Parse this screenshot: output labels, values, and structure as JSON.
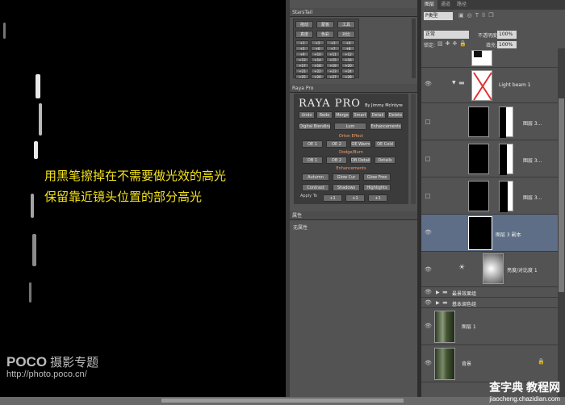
{
  "canvas": {
    "annotation_line1": "用黑笔擦掉在不需要做光效的高光",
    "annotation_line2": "保留靠近镜头位置的部分高光",
    "watermark_brand": "POCO",
    "watermark_sub": "摄影专题",
    "watermark_url": "http://photo.poco.cn/"
  },
  "startail": {
    "title": "StarsTail",
    "row1": [
      "拖动",
      "蒙板",
      "工具"
    ],
    "row2": [
      "真度",
      "色彩",
      "对比"
    ],
    "grid": [
      "+1",
      "+2",
      "+3",
      "+4",
      "+5",
      "+6",
      "+7",
      "+8",
      "+9",
      "+10",
      "+11",
      "+12",
      "+13",
      "+14",
      "+15",
      "+16",
      "+17",
      "+18",
      "+19",
      "+20",
      "+21",
      "+22",
      "+23",
      "+24",
      "+25",
      "+26",
      "+27",
      "+28"
    ]
  },
  "raya": {
    "tab": "Raya Pro",
    "logo": "RAYA PRO",
    "byline": "By Jimmy McIntyre",
    "row1": [
      "Undo",
      "Redo",
      "Merge",
      "Smart",
      "Detail",
      "Delete"
    ],
    "tabs": [
      "Digital Blending",
      "Lum",
      "Enhancements"
    ],
    "orton_label": "Orton Effect",
    "orton": [
      "OE 1",
      "OE 2",
      "OE Warm",
      "OE Cold"
    ],
    "dodge_label": "Dodge/Burn",
    "dodge": [
      "DB 1",
      "DB 2",
      "DB Details",
      "Details"
    ],
    "enh_label": "Enhancements",
    "enh1": [
      "Autumn",
      "Glow Cur",
      "Glow Free"
    ],
    "enh2": [
      "Contrast",
      "Shadows",
      "Highlights"
    ],
    "apply_label": "Apply To",
    "apply": [
      "+1",
      "+1",
      "+1"
    ]
  },
  "properties": {
    "title": "属性",
    "content": "无属性"
  },
  "layers": {
    "tabs": [
      "图层",
      "通道",
      "路径"
    ],
    "filter_type": "P类型",
    "blend_mode": "正常",
    "opacity_label": "不透明度:",
    "opacity_value": "100%",
    "lock_label": "锁定:",
    "fill_label": "填充:",
    "fill_value": "100%",
    "items": [
      {
        "name": "Light beam 1"
      },
      {
        "name": "图层 3..."
      },
      {
        "name": "图层 3..."
      },
      {
        "name": "图层 3..."
      },
      {
        "name": "图层 3 副本"
      },
      {
        "name": "亮度/对比度 1"
      },
      {
        "name": "最景效果组"
      },
      {
        "name": "基本调色组"
      },
      {
        "name": "图层 1"
      },
      {
        "name": "背景"
      }
    ]
  },
  "site_watermark": {
    "name": "查字典 教程网",
    "url": "jiaocheng.chazidian.com"
  }
}
